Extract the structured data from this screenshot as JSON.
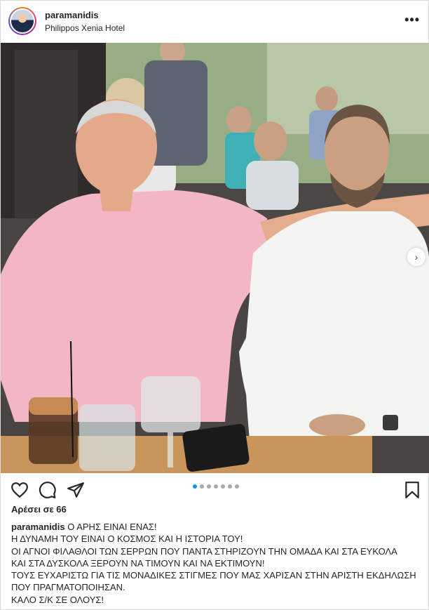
{
  "header": {
    "username": "paramanidis",
    "location": "Philippos Xenia Hotel",
    "more_label": "•••"
  },
  "photo": {
    "description_icon": "photo-image",
    "next_label": "›"
  },
  "carousel": {
    "total": 7,
    "active_index": 0
  },
  "actions": {
    "like_icon": "heart-icon",
    "comment_icon": "comment-icon",
    "share_icon": "share-icon",
    "save_icon": "bookmark-icon"
  },
  "likes": {
    "text": "Αρέσει σε 66"
  },
  "caption": {
    "username": "paramanidis",
    "lines": [
      " Ο ΑΡΗΣ ΕΙΝΑΙ ΕΝΑΣ!",
      "Η ΔΥΝΑΜΗ ΤΟΥ ΕΙΝΑΙ Ο ΚΟΣΜΟΣ ΚΑΙ Η ΙΣΤΟΡΙΑ ΤΟΥ!",
      "ΟΙ ΑΓΝΟΙ ΦΙΛΑΘΛΟΙ ΤΩΝ ΣΕΡΡΩΝ ΠΟΥ ΠΑΝΤΑ ΣΤΗΡΙΖΟΥΝ ΤΗΝ ΟΜΑΔΑ ΚΑΙ ΣΤΑ ΕΥΚΟΛΑ",
      "ΚΑΙ ΣΤΑ ΔΥΣΚΟΛΑ ΞΕΡΟΥΝ ΝΑ ΤΙΜΟΥΝ ΚΑΙ ΝΑ ΕΚΤΙΜΟΥΝ!",
      "ΤΟΥΣ ΕΥΧΑΡΙΣΤΩ ΓΙΑ ΤΙΣ ΜΟΝΑΔΙΚΕΣ ΣΤΙΓΜΕΣ ΠΟΥ ΜΑΣ ΧΑΡΙΣΑΝ ΣΤΗΝ ΑΡΙΣΤΗ ΕΚΔΗΛΩΣΗ",
      "ΠΟΥ ΠΡΑΓΜΑΤΟΠΟΙΗΣΑΝ.",
      "ΚΑΛΟ Σ/Κ ΣΕ ΟΛΟΥΣ!"
    ]
  },
  "colors": {
    "text": "#262626",
    "accent_dot": "#0095f6",
    "inactive_dot": "#a8a8a8",
    "border": "#dbdbdb"
  }
}
